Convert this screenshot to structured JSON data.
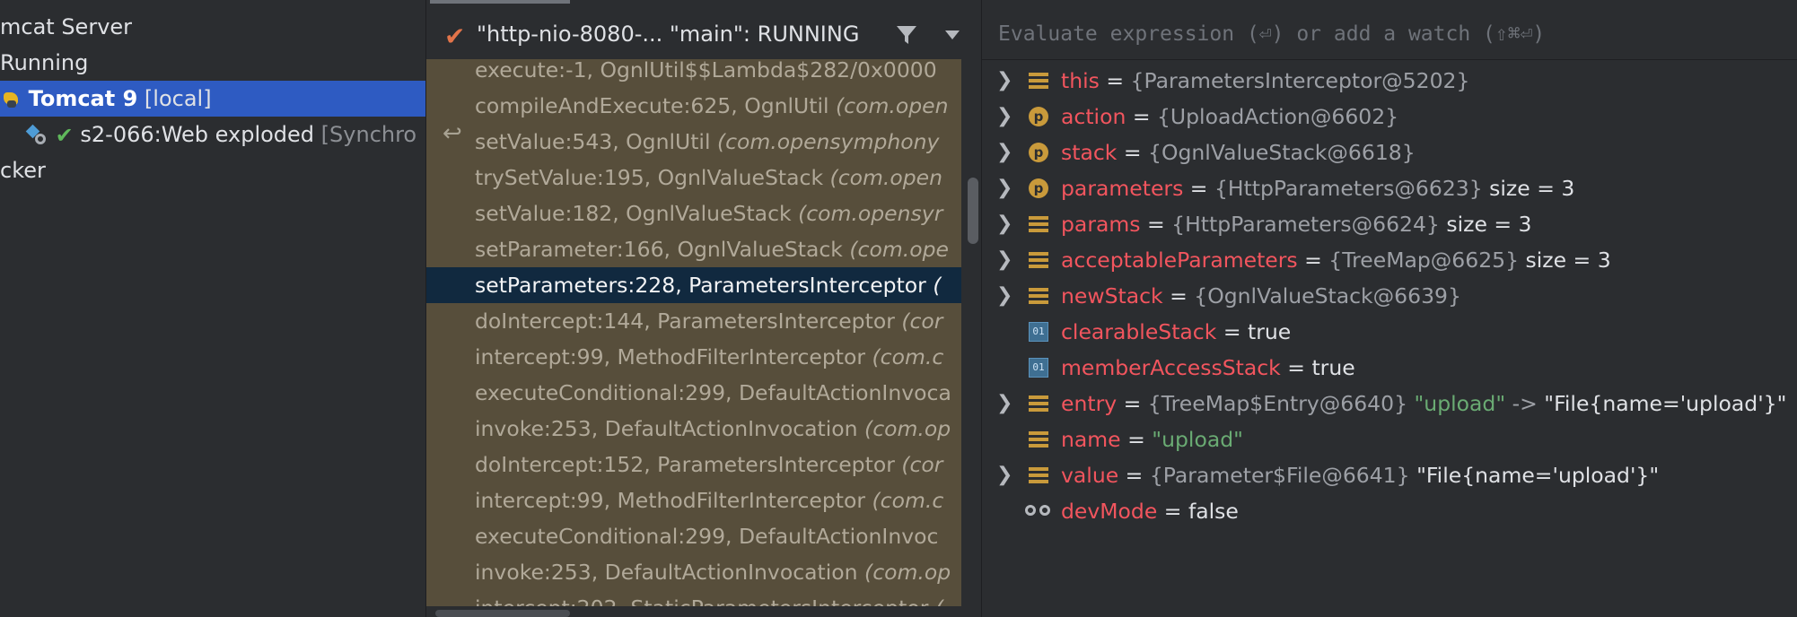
{
  "services": {
    "items": [
      {
        "text": "mcat Server"
      },
      {
        "text": "Running"
      },
      {
        "name": "Tomcat 9",
        "suffix": " [local]",
        "selected": true
      },
      {
        "name": "s2-066:Web exploded",
        "suffix": " [Synchro"
      },
      {
        "text": "cker"
      }
    ]
  },
  "frames": {
    "thread_label": "\"http-nio-8080-... \"main\": RUNNING",
    "items": [
      {
        "method": "execute:-1, OgnlUtil$$Lambda$282/0x0000",
        "pkg": ""
      },
      {
        "method": "compileAndExecute:625, OgnlUtil ",
        "pkg": "(com.open"
      },
      {
        "method": "setValue:543, OgnlUtil ",
        "pkg": "(com.opensymphony"
      },
      {
        "method": "trySetValue:195, OgnlValueStack ",
        "pkg": "(com.open"
      },
      {
        "method": "setValue:182, OgnlValueStack ",
        "pkg": "(com.opensyr"
      },
      {
        "method": "setParameter:166, OgnlValueStack ",
        "pkg": "(com.ope"
      },
      {
        "method": "setParameters:228, ParametersInterceptor ",
        "pkg": "("
      },
      {
        "method": "doIntercept:144, ParametersInterceptor ",
        "pkg": "(cor"
      },
      {
        "method": "intercept:99, MethodFilterInterceptor ",
        "pkg": "(com.c"
      },
      {
        "method": "executeConditional:299, DefaultActionInvoca",
        "pkg": ""
      },
      {
        "method": "invoke:253, DefaultActionInvocation ",
        "pkg": "(com.op"
      },
      {
        "method": "doIntercept:152, ParametersInterceptor ",
        "pkg": "(cor"
      },
      {
        "method": "intercept:99, MethodFilterInterceptor ",
        "pkg": "(com.c"
      },
      {
        "method": "executeConditional:299, DefaultActionInvoc",
        "pkg": ""
      },
      {
        "method": "invoke:253, DefaultActionInvocation ",
        "pkg": "(com.op"
      },
      {
        "method": "intercept:202, StaticParametersInterceptor ",
        "pkg": "("
      }
    ],
    "selected_index": 6
  },
  "variables": {
    "eval_placeholder": "Evaluate expression (⏎) or add a watch (⇧⌘⏎)",
    "items": [
      {
        "name": "this",
        "value": "{ParametersInterceptor@5202}",
        "extra": "",
        "icon": "field"
      },
      {
        "name": "action",
        "value": "{UploadAction@6602}",
        "extra": "",
        "icon": "protected"
      },
      {
        "name": "stack",
        "value": "{OgnlValueStack@6618}",
        "extra": "",
        "icon": "protected"
      },
      {
        "name": "parameters",
        "value": "{HttpParameters@6623}",
        "extra": "  size = 3",
        "icon": "protected"
      },
      {
        "name": "params",
        "value": "{HttpParameters@6624}",
        "extra": "  size = 3",
        "icon": "field"
      },
      {
        "name": "acceptableParameters",
        "value": "{TreeMap@6625}",
        "extra": "  size = 3",
        "icon": "field"
      },
      {
        "name": "newStack",
        "value": "{OgnlValueStack@6639}",
        "extra": "",
        "icon": "field"
      },
      {
        "name": "clearableStack",
        "value": "true",
        "extra": "",
        "icon": "primitive"
      },
      {
        "name": "memberAccessStack",
        "value": "true",
        "extra": "",
        "icon": "primitive"
      },
      {
        "name": "entry",
        "value": "{TreeMap$Entry@6640} ",
        "str": "\"upload\"",
        "arrow": " -> ",
        "extra": "\"File{name='upload'}\"",
        "icon": "field"
      },
      {
        "name": "name",
        "value": "",
        "str": "\"upload\"",
        "extra": "",
        "icon": "field"
      },
      {
        "name": "value",
        "value": "{Parameter$File@6641} ",
        "extra": "\"File{name='upload'}\"",
        "icon": "field"
      },
      {
        "name": "devMode",
        "value": "false",
        "extra": "",
        "icon": "watch"
      }
    ]
  },
  "colors": {
    "selection_blue": "#2e5bc2",
    "frames_bg": "#574e3b",
    "frame_selected": "#11293f",
    "var_name": "#f2555e",
    "string": "#6aab73"
  }
}
